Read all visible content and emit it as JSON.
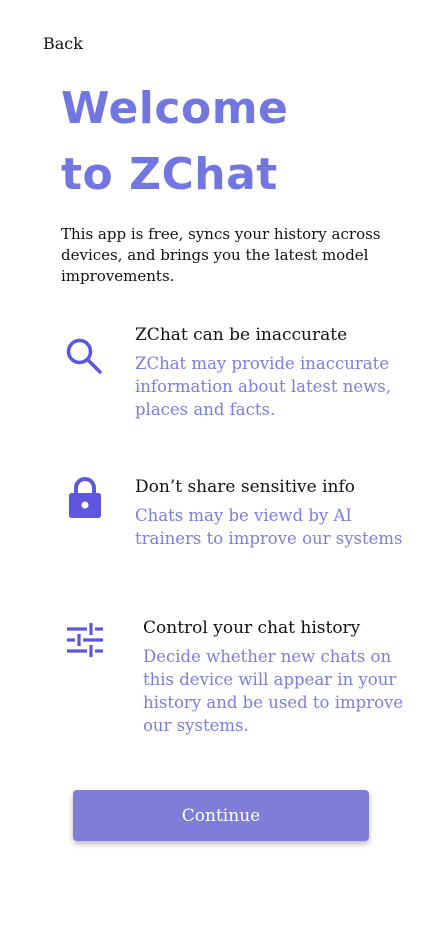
{
  "header": {
    "back_label": "Back"
  },
  "welcome": {
    "title_line1": "Welcome",
    "title_line2": "to ZChat",
    "intro": "This app is free, syncs your history across devices, and brings you the latest model improvements."
  },
  "features": [
    {
      "icon": "search-icon",
      "title": "ZChat can be inaccurate",
      "description": "ZChat may provide inaccurate information about latest news, places and facts."
    },
    {
      "icon": "lock-icon",
      "title": "Don’t share sensitive info",
      "description": "Chats may be viewd by AI trainers to improve our systems"
    },
    {
      "icon": "sliders-icon",
      "title": "Control your chat history",
      "description": "Decide whether new chats on this device will appear in your history and be used to improve our systems."
    }
  ],
  "actions": {
    "continue_label": "Continue"
  },
  "colors": {
    "accent": "#7276e0",
    "description": "#7b7ee0",
    "button": "#7f7dd7",
    "icon": "#5d57e0"
  }
}
